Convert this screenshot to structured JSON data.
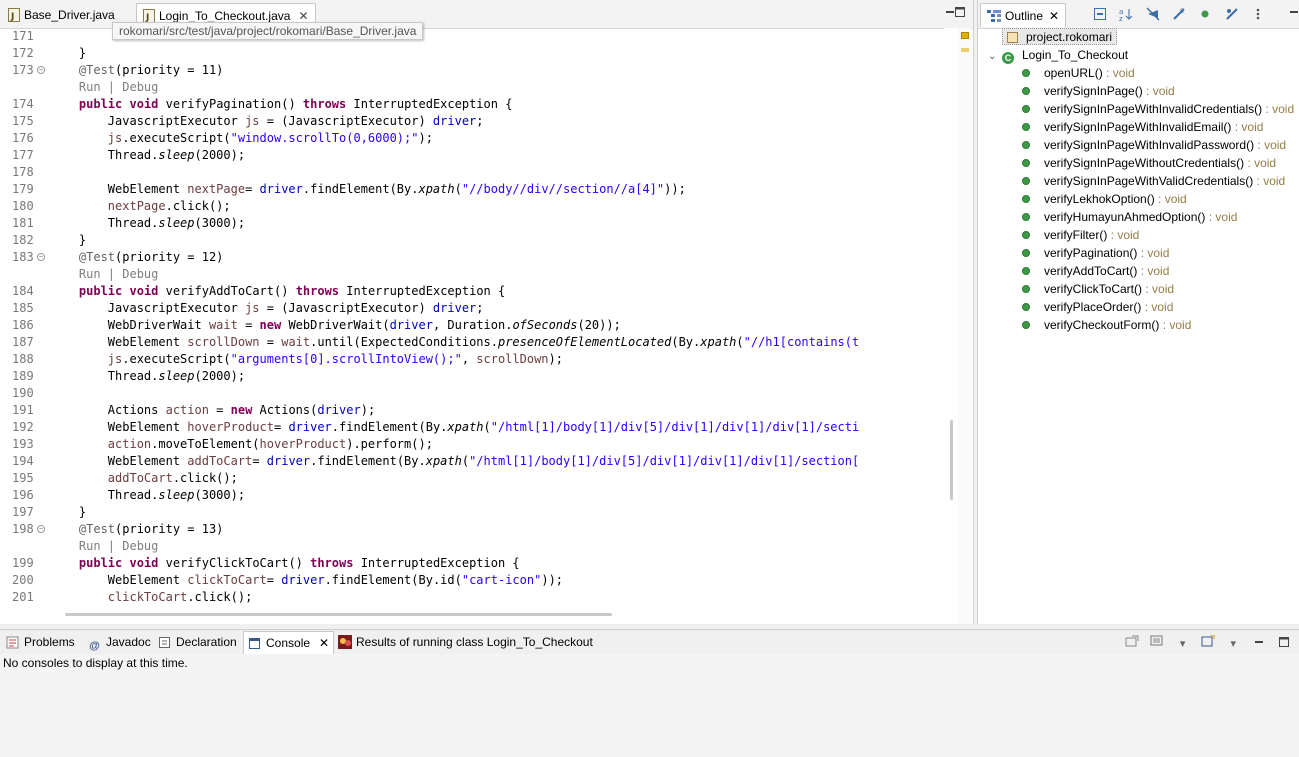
{
  "editor": {
    "tabs": [
      {
        "label": "Base_Driver.java",
        "active": false
      },
      {
        "label": "Login_To_Checkout.java",
        "active": true
      }
    ],
    "tooltip": "rokomari/src/test/java/project/rokomari/Base_Driver.java",
    "close_glyph": "✕",
    "lines": [
      {
        "n": "171",
        "fold": false,
        "html": ""
      },
      {
        "n": "172",
        "fold": false,
        "html": "    }"
      },
      {
        "n": "173",
        "fold": true,
        "html": "    <span class='ann'>@Test</span>(priority = 11)"
      },
      {
        "n": "",
        "fold": false,
        "html": "    <span class='codelens'>Run | Debug</span>"
      },
      {
        "n": "174",
        "fold": false,
        "html": "    <span class='kw'>public</span> <span class='kw'>void</span> verifyPagination() <span class='kw'>throws</span> InterruptedException {"
      },
      {
        "n": "175",
        "fold": false,
        "html": "        JavascriptExecutor <span class='lv'>js</span> = (JavascriptExecutor) <span class='fld'>driver</span>;"
      },
      {
        "n": "176",
        "fold": false,
        "html": "        <span class='lv'>js</span>.executeScript(<span class='str'>\"window.scrollTo(0,6000);\"</span>);"
      },
      {
        "n": "177",
        "fold": false,
        "html": "        Thread.<span class='it'>sleep</span>(2000);"
      },
      {
        "n": "178",
        "fold": false,
        "html": ""
      },
      {
        "n": "179",
        "fold": false,
        "html": "        WebElement <span class='lv'>nextPage</span>= <span class='fld'>driver</span>.findElement(By.<span class='it'>xpath</span>(<span class='str'>\"//body//div//section//a[4]\"</span>));"
      },
      {
        "n": "180",
        "fold": false,
        "html": "        <span class='lv'>nextPage</span>.click();"
      },
      {
        "n": "181",
        "fold": false,
        "html": "        Thread.<span class='it'>sleep</span>(3000);"
      },
      {
        "n": "182",
        "fold": false,
        "html": "    }"
      },
      {
        "n": "183",
        "fold": true,
        "html": "    <span class='ann'>@Test</span>(priority = 12)"
      },
      {
        "n": "",
        "fold": false,
        "html": "    <span class='codelens'>Run | Debug</span>"
      },
      {
        "n": "184",
        "fold": false,
        "html": "    <span class='kw'>public</span> <span class='kw'>void</span> verifyAddToCart() <span class='kw'>throws</span> InterruptedException {"
      },
      {
        "n": "185",
        "fold": false,
        "html": "        JavascriptExecutor <span class='lv'>js</span> = (JavascriptExecutor) <span class='fld'>driver</span>;"
      },
      {
        "n": "186",
        "fold": false,
        "html": "        WebDriverWait <span class='lv'>wait</span> = <span class='kw'>new</span> WebDriverWait(<span class='fld'>driver</span>, Duration.<span class='it'>ofSeconds</span>(20));"
      },
      {
        "n": "187",
        "fold": false,
        "html": "        WebElement <span class='lv'>scrollDown</span> = <span class='lv'>wait</span>.until(ExpectedConditions.<span class='it'>presenceOfElementLocated</span>(By.<span class='it'>xpath</span>(<span class='str'>\"//h1[contains(t</span>"
      },
      {
        "n": "188",
        "fold": false,
        "html": "        <span class='lv'>js</span>.executeScript(<span class='str'>\"arguments[0].scrollIntoView();\"</span>, <span class='lv'>scrollDown</span>);"
      },
      {
        "n": "189",
        "fold": false,
        "html": "        Thread.<span class='it'>sleep</span>(2000);"
      },
      {
        "n": "190",
        "fold": false,
        "html": ""
      },
      {
        "n": "191",
        "fold": false,
        "html": "        Actions <span class='lv'>action</span> = <span class='kw'>new</span> Actions(<span class='fld'>driver</span>);"
      },
      {
        "n": "192",
        "fold": false,
        "html": "        WebElement <span class='lv'>hoverProduct</span>= <span class='fld'>driver</span>.findElement(By.<span class='it'>xpath</span>(<span class='str'>\"/html[1]/body[1]/div[5]/div[1]/div[1]/div[1]/secti</span>"
      },
      {
        "n": "193",
        "fold": false,
        "html": "        <span class='lv'>action</span>.moveToElement(<span class='lv'>hoverProduct</span>).perform();"
      },
      {
        "n": "194",
        "fold": false,
        "html": "        WebElement <span class='lv'>addToCart</span>= <span class='fld'>driver</span>.findElement(By.<span class='it'>xpath</span>(<span class='str'>\"/html[1]/body[1]/div[5]/div[1]/div[1]/div[1]/section[</span>"
      },
      {
        "n": "195",
        "fold": false,
        "html": "        <span class='lv'>addToCart</span>.click();"
      },
      {
        "n": "196",
        "fold": false,
        "html": "        Thread.<span class='it'>sleep</span>(3000);"
      },
      {
        "n": "197",
        "fold": false,
        "html": "    }"
      },
      {
        "n": "198",
        "fold": true,
        "html": "    <span class='ann'>@Test</span>(priority = 13)"
      },
      {
        "n": "",
        "fold": false,
        "html": "    <span class='codelens'>Run | Debug</span>"
      },
      {
        "n": "199",
        "fold": false,
        "html": "    <span class='kw'>public</span> <span class='kw'>void</span> verifyClickToCart() <span class='kw'>throws</span> InterruptedException {"
      },
      {
        "n": "200",
        "fold": false,
        "html": "        WebElement <span class='lv'>clickToCart</span>= <span class='fld'>driver</span>.findElement(By.id(<span class='str'>\"cart-icon\"</span>));"
      },
      {
        "n": "201",
        "fold": false,
        "html": "        <span class='lv'>clickToCart</span>.click();"
      }
    ]
  },
  "outline": {
    "tab_label": "Outline",
    "package": "project.rokomari",
    "class_name": "Login_To_Checkout",
    "class_icon_letter": "C",
    "methods": [
      {
        "name": "openURL()",
        "ret": " : void"
      },
      {
        "name": "verifySignInPage()",
        "ret": " : void"
      },
      {
        "name": "verifySignInPageWithInvalidCredentials()",
        "ret": " : void"
      },
      {
        "name": "verifySignInPageWithInvalidEmail()",
        "ret": " : void"
      },
      {
        "name": "verifySignInPageWithInvalidPassword()",
        "ret": " : void"
      },
      {
        "name": "verifySignInPageWithoutCredentials()",
        "ret": " : void"
      },
      {
        "name": "verifySignInPageWithValidCredentials()",
        "ret": " : void"
      },
      {
        "name": "verifyLekhokOption()",
        "ret": " : void"
      },
      {
        "name": "verifyHumayunAhmedOption()",
        "ret": " : void"
      },
      {
        "name": "verifyFilter()",
        "ret": " : void"
      },
      {
        "name": "verifyPagination()",
        "ret": " : void"
      },
      {
        "name": "verifyAddToCart()",
        "ret": " : void"
      },
      {
        "name": "verifyClickToCart()",
        "ret": " : void"
      },
      {
        "name": "verifyPlaceOrder()",
        "ret": " : void"
      },
      {
        "name": "verifyCheckoutForm()",
        "ret": " : void"
      }
    ]
  },
  "bottom": {
    "tabs": [
      {
        "label": "Problems",
        "icon": "problems-icon",
        "active": false
      },
      {
        "label": "Javadoc",
        "icon": "javadoc-icon",
        "active": false
      },
      {
        "label": "Declaration",
        "icon": "declaration-icon",
        "active": false
      },
      {
        "label": "Console",
        "icon": "console-icon",
        "active": true
      },
      {
        "label": "Results of running class Login_To_Checkout",
        "icon": "testng-results-icon",
        "active": false
      }
    ],
    "console_message": "No consoles to display at this time."
  }
}
